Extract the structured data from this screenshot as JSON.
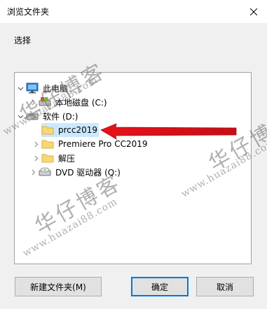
{
  "window": {
    "title": "浏览文件夹"
  },
  "instruction": "选择",
  "tree": {
    "items": [
      {
        "label": "此电脑",
        "icon": "computer-icon",
        "toggle": "expanded"
      },
      {
        "label": "本地磁盘 (C:)",
        "icon": "drive-icon",
        "toggle": "collapsed"
      },
      {
        "label": "软件 (D:)",
        "icon": "drive-icon",
        "toggle": "expanded"
      },
      {
        "label": "prcc2019",
        "icon": "folder-icon",
        "toggle": "none",
        "selected": true
      },
      {
        "label": "Premiere Pro CC2019",
        "icon": "folder-icon",
        "toggle": "collapsed"
      },
      {
        "label": "解压",
        "icon": "folder-icon",
        "toggle": "collapsed"
      },
      {
        "label": "DVD 驱动器 (Q:)",
        "icon": "dvd-drive-icon",
        "toggle": "collapsed"
      }
    ]
  },
  "buttons": {
    "new_folder": "新建文件夹(M)",
    "ok": "确定",
    "cancel": "取消"
  },
  "watermarks": {
    "brand": "华仔博客",
    "url": "www.huazai88.com"
  },
  "colors": {
    "selection": "#cce8ff",
    "folder": "#f8d775",
    "arrow": "#e8121a",
    "accent": "#0078d7"
  }
}
